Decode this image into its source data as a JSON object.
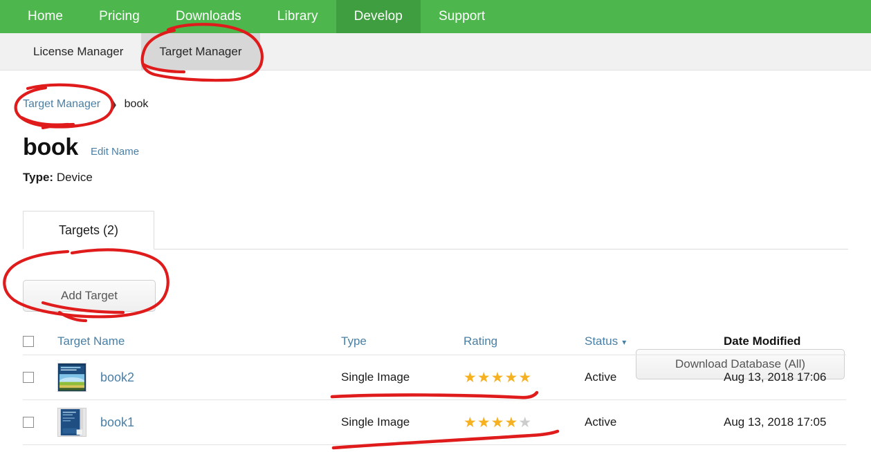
{
  "topnav": {
    "items": [
      {
        "label": "Home",
        "active": false
      },
      {
        "label": "Pricing",
        "active": false
      },
      {
        "label": "Downloads",
        "active": false
      },
      {
        "label": "Library",
        "active": false
      },
      {
        "label": "Develop",
        "active": true
      },
      {
        "label": "Support",
        "active": false
      }
    ],
    "bg_color": "#4db74d",
    "active_bg_color": "#3f9e3f"
  },
  "subnav": {
    "items": [
      {
        "label": "License Manager",
        "active": false
      },
      {
        "label": "Target Manager",
        "active": true
      }
    ]
  },
  "breadcrumb": {
    "parent": "Target Manager",
    "separator": "❯",
    "current": "book"
  },
  "header": {
    "title": "book",
    "edit_name_label": "Edit Name",
    "type_label": "Type:",
    "type_value": "Device"
  },
  "tabs": [
    {
      "label": "Targets (2)",
      "active": true
    }
  ],
  "toolbar": {
    "add_target_label": "Add Target",
    "download_database_label": "Download Database (All)"
  },
  "table": {
    "columns": [
      {
        "key": "check",
        "label": ""
      },
      {
        "key": "name",
        "label": "Target Name",
        "sorted": false
      },
      {
        "key": "type",
        "label": "Type",
        "sorted": false
      },
      {
        "key": "rating",
        "label": "Rating",
        "sorted": false
      },
      {
        "key": "status",
        "label": "Status",
        "sorted": false,
        "chevron": "▾"
      },
      {
        "key": "date",
        "label": "Date Modified",
        "sorted": true
      }
    ],
    "rows": [
      {
        "name": "book2",
        "type": "Single Image",
        "rating": 5,
        "rating_max": 5,
        "status": "Active",
        "date": "Aug 13, 2018 17:06",
        "thumb": "book-cover-landscape"
      },
      {
        "name": "book1",
        "type": "Single Image",
        "rating": 4,
        "rating_max": 5,
        "status": "Active",
        "date": "Aug 13, 2018 17:05",
        "thumb": "book-cover-blue"
      }
    ]
  },
  "colors": {
    "link": "#4a7fa5",
    "star_filled": "#f5b122",
    "star_empty": "#cccccc",
    "annotation": "#e01b1b"
  },
  "annotations": {
    "description": "red hand-drawn marker circles and underlines",
    "marks": [
      "circle-target-manager-subnav",
      "circle-breadcrumb-target-manager",
      "circle-add-target-button",
      "underline-row-book2",
      "underline-row-book1"
    ]
  }
}
